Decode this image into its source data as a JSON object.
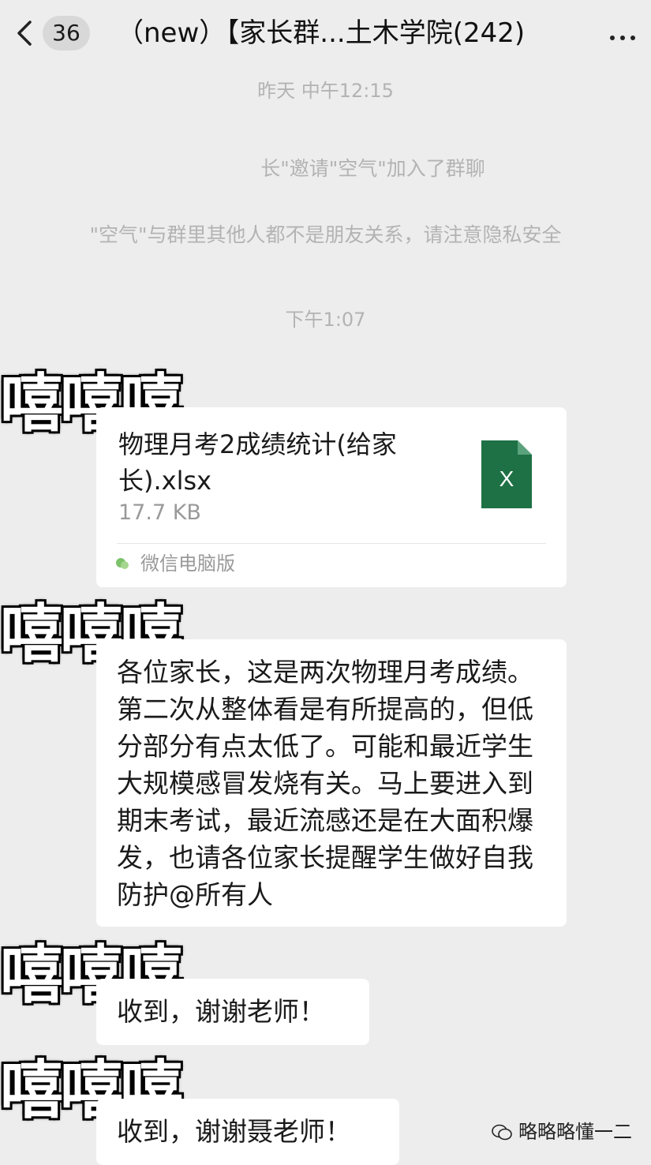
{
  "header": {
    "back_count": "36",
    "title": "（new）【家长群...土木学院(242)"
  },
  "system_messages": {
    "time1": "昨天 中午12:15",
    "invite": "长\"邀请\"空气\"加入了群聊",
    "privacy": "\"空气\"与群里其他人都不是朋友关系，请注意隐私安全",
    "time2": "下午1:07"
  },
  "avatars": {
    "sender1": "嘻嘻嘻",
    "sender2": "嘻嘻嘻",
    "sender3": "嘻嘻嘻",
    "sender4": "嘻嘻嘻"
  },
  "file_message": {
    "name": "物理月考2成绩统计(给家长).xlsx",
    "size": "17.7 KB",
    "source": "微信电脑版",
    "icon_label": "X",
    "icon": "excel-file-icon",
    "icon_color": "#1e7145"
  },
  "messages": [
    {
      "text": "各位家长，这是两次物理月考成绩。第二次从整体看是有所提高的，但低分部分有点太低了。可能和最近学生大规模感冒发烧有关。马上要进入到期末考试，最近流感还是在大面积爆发，也请各位家长提醒学生做好自我防护@所有人"
    },
    {
      "text": "收到，谢谢老师！"
    },
    {
      "text": "收到，谢谢聂老师！"
    }
  ],
  "watermark": {
    "text": "略略略懂一二"
  }
}
